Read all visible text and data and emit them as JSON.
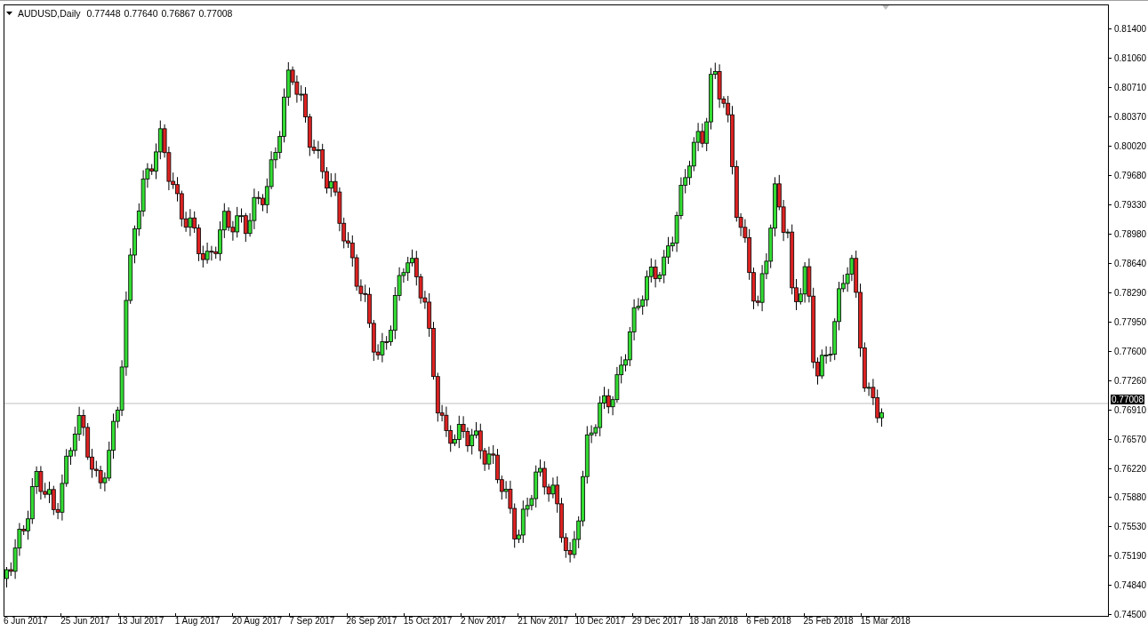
{
  "chart_header": {
    "symbol": "AUDUSD,Daily",
    "ohlc": [
      "0.77448",
      "0.77640",
      "0.76867",
      "0.77008"
    ]
  },
  "y_axis": {
    "ticks": [
      "0.81400",
      "0.81060",
      "0.80710",
      "0.80370",
      "0.80020",
      "0.79680",
      "0.79330",
      "0.78980",
      "0.78640",
      "0.78290",
      "0.77950",
      "0.77600",
      "0.77260",
      "0.76910",
      "0.76570",
      "0.76220",
      "0.75880",
      "0.75530",
      "0.75190",
      "0.74840",
      "0.74500"
    ],
    "current_price": "0.77008"
  },
  "x_axis": {
    "labels": [
      "6 Jun 2017",
      "25 Jun 2017",
      "13 Jul 2017",
      "1 Aug 2017",
      "20 Aug 2017",
      "7 Sep 2017",
      "26 Sep 2017",
      "15 Oct 2017",
      "2 Nov 2017",
      "21 Nov 2017",
      "10 Dec 2017",
      "29 Dec 2017",
      "18 Jan 2018",
      "6 Feb 2018",
      "25 Feb 2018",
      "15 Mar 2018"
    ]
  }
}
